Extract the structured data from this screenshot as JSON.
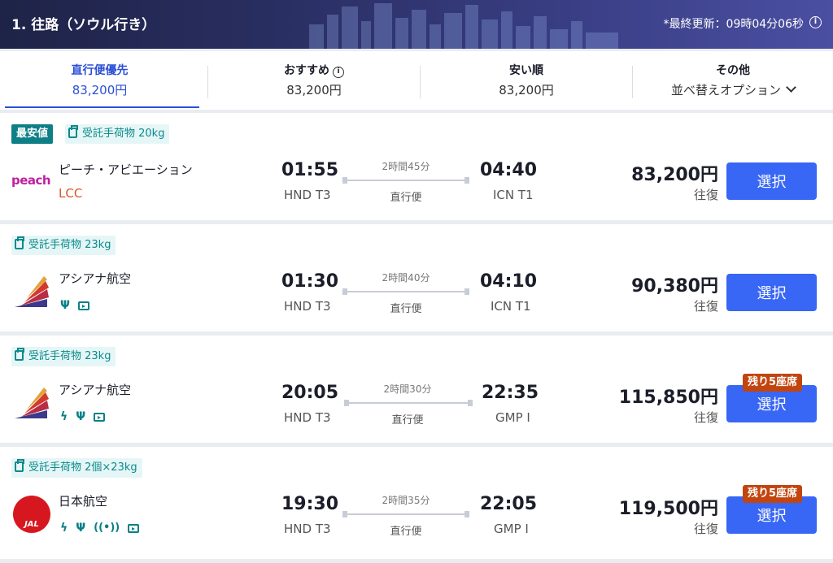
{
  "header": {
    "title": "1. 往路（ソウル行き）",
    "last_updated": "*最終更新：09時04分06秒",
    "info_icon": "info-icon"
  },
  "tabs": [
    {
      "label": "直行便優先",
      "price": "83,200円",
      "active": true
    },
    {
      "label": "おすすめ",
      "price": "83,200円",
      "info": true
    },
    {
      "label": "安い順",
      "price": "83,200円"
    },
    {
      "label": "その他",
      "price": "並べ替えオプション",
      "dropdown": true
    }
  ],
  "flights": [
    {
      "best_badge": "最安値",
      "baggage": "受託手荷物 20kg",
      "airline": "ピーチ・アビエーション",
      "logo_text": "peach",
      "lcc_label": "LCC",
      "amenities": [],
      "dep_time": "01:55",
      "dep_airport": "HND T3",
      "duration": "2時間45分",
      "direct": "直行便",
      "arr_time": "04:40",
      "arr_airport": "ICN T1",
      "price": "83,200円",
      "trip_type": "往復",
      "button": "選択",
      "seats_left": ""
    },
    {
      "best_badge": "",
      "baggage": "受託手荷物 23kg",
      "airline": "アシアナ航空",
      "lcc_label": "",
      "amenities": [
        "meal-icon",
        "entertainment-icon"
      ],
      "dep_time": "01:30",
      "dep_airport": "HND T3",
      "duration": "2時間40分",
      "direct": "直行便",
      "arr_time": "04:10",
      "arr_airport": "ICN T1",
      "price": "90,380円",
      "trip_type": "往復",
      "button": "選択",
      "seats_left": ""
    },
    {
      "best_badge": "",
      "baggage": "受託手荷物 23kg",
      "airline": "アシアナ航空",
      "lcc_label": "",
      "amenities": [
        "power-icon",
        "meal-icon",
        "entertainment-icon"
      ],
      "dep_time": "20:05",
      "dep_airport": "HND T3",
      "duration": "2時間30分",
      "direct": "直行便",
      "arr_time": "22:35",
      "arr_airport": "GMP I",
      "price": "115,850円",
      "trip_type": "往復",
      "button": "選択",
      "seats_left": "残り5座席"
    },
    {
      "best_badge": "",
      "baggage": "受託手荷物 2個×23kg",
      "airline": "日本航空",
      "logo_text": "JAL",
      "lcc_label": "",
      "amenities": [
        "power-icon",
        "meal-icon",
        "wifi-icon",
        "entertainment-icon"
      ],
      "dep_time": "19:30",
      "dep_airport": "HND T3",
      "duration": "2時間35分",
      "direct": "直行便",
      "arr_time": "22:05",
      "arr_airport": "GMP I",
      "price": "119,500円",
      "trip_type": "往復",
      "button": "選択",
      "seats_left": "残り5座席"
    }
  ],
  "colors": {
    "accent": "#2b4fd6",
    "select_button": "#3866f5",
    "teal": "#0a8a8c",
    "lcc": "#d8552b",
    "seats_badge": "#c2450f"
  }
}
